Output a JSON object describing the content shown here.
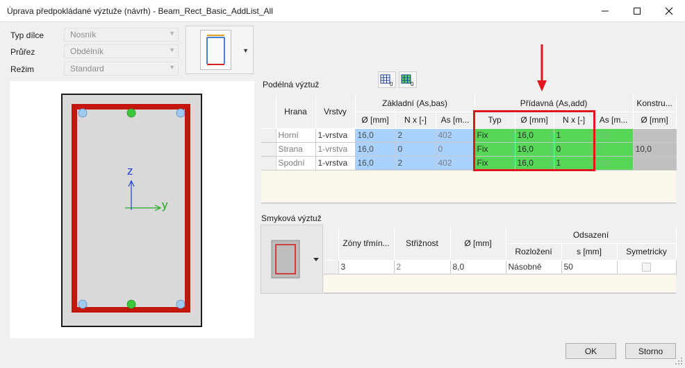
{
  "window": {
    "title": "Úprava předpokládané výztuže (návrh) - Beam_Rect_Basic_AddList_All"
  },
  "properties": [
    {
      "label": "Typ dílce",
      "value": "Nosník"
    },
    {
      "label": "Průřez",
      "value": "Obdélník"
    },
    {
      "label": "Režim",
      "value": "Standard"
    }
  ],
  "cross_section": {
    "axis_z": "z",
    "axis_y": "y",
    "colors": {
      "stirrup": "#c3160e",
      "bar_corner": "#9fc9ef",
      "bar_added": "#3cc63c",
      "concrete": "#d9d9d9"
    }
  },
  "longitudinal": {
    "title": "Podélná výztuž",
    "icon_buttons": [
      {
        "icon": "grid-zero-icon",
        "sub": "0"
      },
      {
        "icon": "grid-zero-green-icon",
        "sub": "0"
      }
    ],
    "groups": {
      "zakladni": "Základní (As,bas)",
      "pridavna": "Přídavná (As,add)",
      "konstru": "Konstru..."
    },
    "headers": {
      "hrana": "Hrana",
      "vrstvy": "Vrstvy",
      "bas_diam": "Ø [mm]",
      "bas_n": "N x [-]",
      "bas_as": "As [m...",
      "add_typ": "Typ",
      "add_diam": "Ø [mm]",
      "add_n": "N x [-]",
      "add_as": "As [m...",
      "kon_diam": "Ø [mm]"
    },
    "rows": [
      {
        "hrana": "Horní",
        "vrstvy": "1-vrstva",
        "bas_diam": "16,0",
        "bas_n": "2",
        "bas_as": "402",
        "add_typ": "Fix",
        "add_diam": "16,0",
        "add_n": "1",
        "add_as": "201",
        "kon_diam": ""
      },
      {
        "hrana": "Strana",
        "vrstvy": "1-vrstva",
        "bas_diam": "16,0",
        "bas_n": "0",
        "bas_as": "0",
        "add_typ": "Fix",
        "add_diam": "16,0",
        "add_n": "0",
        "add_as": "0",
        "kon_diam": "10,0"
      },
      {
        "hrana": "Spodní",
        "vrstvy": "1-vrstva",
        "bas_diam": "16,0",
        "bas_n": "2",
        "bas_as": "402",
        "add_typ": "Fix",
        "add_diam": "16,0",
        "add_n": "1",
        "add_as": "201",
        "kon_diam": ""
      }
    ]
  },
  "shear": {
    "title": "Smyková výztuž",
    "headers": {
      "zony": "Zóny třmín...",
      "strih": "Střižnost",
      "diam": "Ø [mm]",
      "odsazeni": "Odsazení",
      "rozlozeni": "Rozložení",
      "s": "s [mm]",
      "symetricky": "Symetricky"
    },
    "rows": [
      {
        "zony": "3",
        "strih": "2",
        "diam": "8,0",
        "rozlozeni": "Násobně",
        "s": "50",
        "symetricky": false
      }
    ]
  },
  "buttons": {
    "ok": "OK",
    "storno": "Storno"
  },
  "annotation": {
    "color": "#e0161c"
  }
}
